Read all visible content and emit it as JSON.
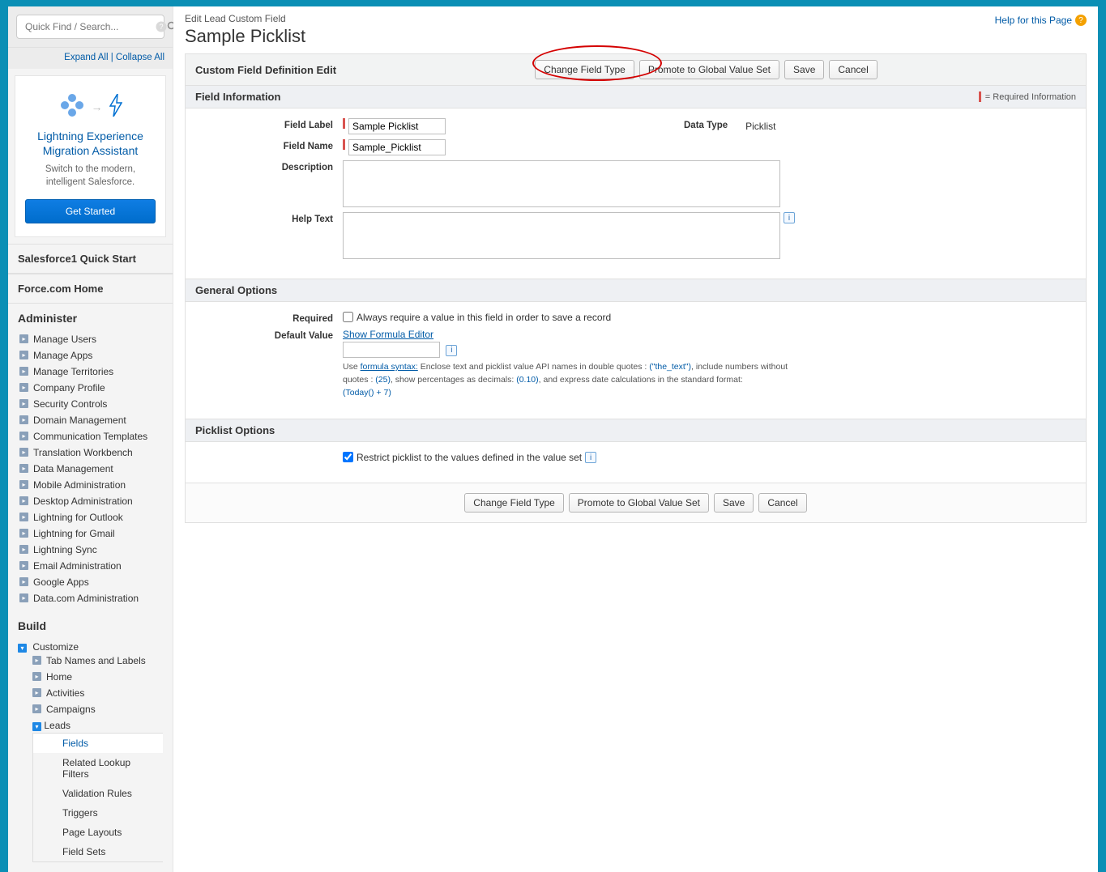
{
  "sidebar": {
    "search_placeholder": "Quick Find / Search...",
    "expand_all": "Expand All",
    "collapse_all": "Collapse All",
    "promo": {
      "title": "Lightning Experience Migration Assistant",
      "subtitle": "Switch to the modern, intelligent Salesforce.",
      "button": "Get Started"
    },
    "quick_start": "Salesforce1 Quick Start",
    "home": "Force.com Home",
    "administer": {
      "title": "Administer",
      "items": [
        "Manage Users",
        "Manage Apps",
        "Manage Territories",
        "Company Profile",
        "Security Controls",
        "Domain Management",
        "Communication Templates",
        "Translation Workbench",
        "Data Management",
        "Mobile Administration",
        "Desktop Administration",
        "Lightning for Outlook",
        "Lightning for Gmail",
        "Lightning Sync",
        "Email Administration",
        "Google Apps",
        "Data.com Administration"
      ]
    },
    "build": {
      "title": "Build",
      "customize": "Customize",
      "items": [
        "Tab Names and Labels",
        "Home",
        "Activities",
        "Campaigns"
      ],
      "leads": "Leads",
      "leads_children": [
        "Fields",
        "Related Lookup Filters",
        "Validation Rules",
        "Triggers",
        "Page Layouts",
        "Field Sets"
      ]
    }
  },
  "main": {
    "help_link": "Help for this Page",
    "breadcrumb": "Edit Lead Custom Field",
    "title": "Sample Picklist",
    "panel_title": "Custom Field Definition Edit",
    "buttons": {
      "change_type": "Change Field Type",
      "promote": "Promote to Global Value Set",
      "save": "Save",
      "cancel": "Cancel"
    },
    "field_info": {
      "section": "Field Information",
      "required_text": "= Required Information",
      "labels": {
        "field_label": "Field Label",
        "field_name": "Field Name",
        "description": "Description",
        "help_text": "Help Text",
        "data_type": "Data Type"
      },
      "values": {
        "field_label": "Sample Picklist",
        "field_name": "Sample_Picklist",
        "data_type": "Picklist"
      }
    },
    "general_options": {
      "section": "General Options",
      "required_label": "Required",
      "required_text": "Always require a value in this field in order to save a record",
      "default_value_label": "Default Value",
      "show_formula": "Show Formula Editor",
      "hint_prefix": "Use ",
      "hint_link": "formula syntax:",
      "hint_1": " Enclose text and picklist value API names in double quotes : ",
      "hint_ex1": "(\"the_text\")",
      "hint_2": ", include numbers without quotes : ",
      "hint_ex2": "(25)",
      "hint_3": ", show percentages as decimals: ",
      "hint_ex3": "(0.10)",
      "hint_4": ", and express date calculations in the standard format: ",
      "hint_ex4": "(Today() + 7)"
    },
    "picklist_options": {
      "section": "Picklist Options",
      "restrict_text": "Restrict picklist to the values defined in the value set"
    }
  }
}
